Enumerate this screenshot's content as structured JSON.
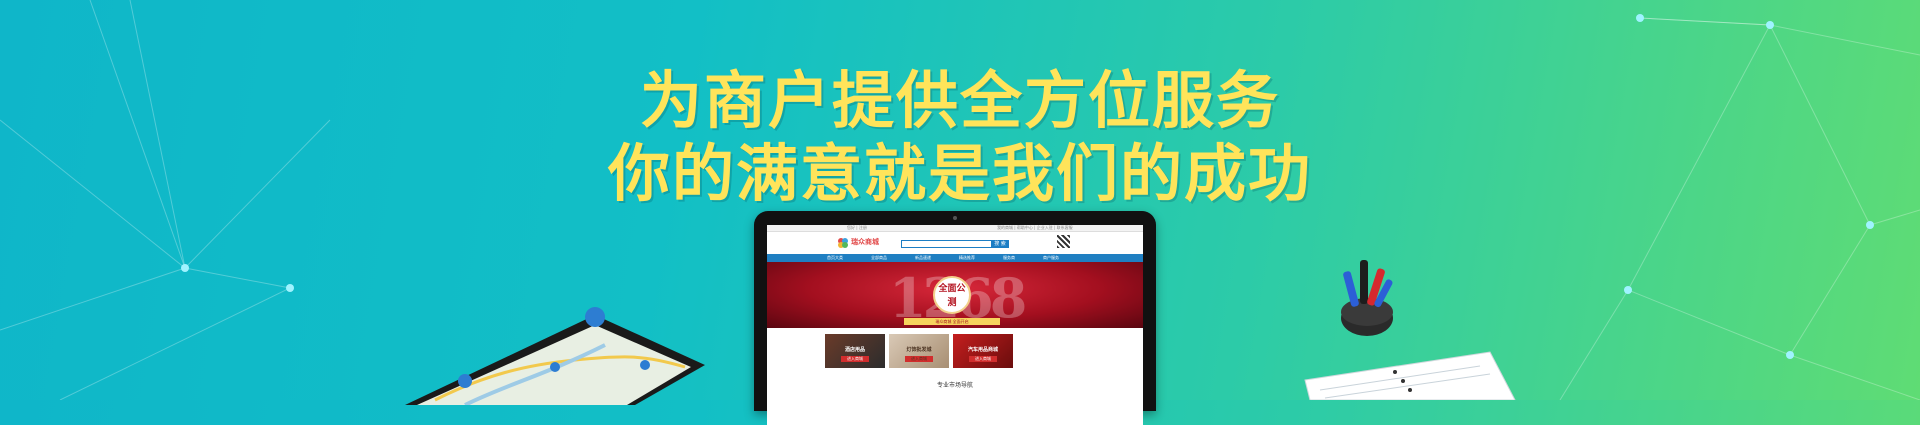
{
  "hero": {
    "line1": "为商户提供全方位服务",
    "line2": "你的满意就是我们的成功"
  },
  "monitor_site": {
    "topbar_left": "您好 | 注册",
    "topbar_right": "我的商城 | 帮助中心 | 企业入驻 | 联系客服",
    "logo_text": "瑞众商城",
    "search_button": "搜 索",
    "nav_items": [
      "首页大类",
      "全部商品",
      "新品速递",
      "精选推荐",
      "服务商",
      "商户服务"
    ],
    "banner_number": "1268",
    "banner_seal": "全面公测",
    "banner_ribbon": "瑞众商城 全面开启",
    "tiles": [
      {
        "title": "酒店用品",
        "button": "进入商城"
      },
      {
        "title": "灯饰批发城",
        "button": "进入商城"
      },
      {
        "title": "汽车用品商城",
        "button": "进入商城"
      }
    ],
    "section_title": "专业市场导航"
  },
  "colors": {
    "headline": "#ffe45a",
    "bg_start": "#0fb6c9",
    "bg_end": "#5fdc74",
    "nav_blue": "#1f7fc2"
  }
}
